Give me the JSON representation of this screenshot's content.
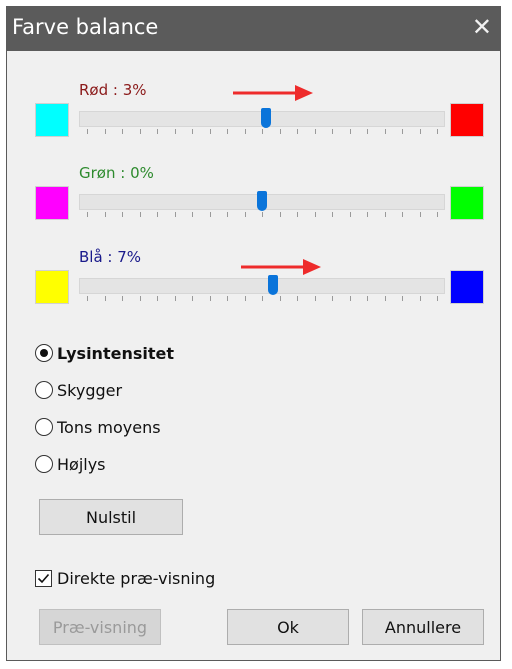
{
  "window": {
    "title": "Farve balance",
    "close_icon": "close-icon"
  },
  "sliders": [
    {
      "label": "Rød : 3%",
      "label_color": "#8b1a1a",
      "value_percent": 3,
      "left_color": "#00ffff",
      "right_color": "#ff0000"
    },
    {
      "label": "Grøn : 0%",
      "label_color": "#2e8b2e",
      "value_percent": 0,
      "left_color": "#ff00ff",
      "right_color": "#00ff00"
    },
    {
      "label": "Blå : 7%",
      "label_color": "#1a1a8b",
      "value_percent": 7,
      "left_color": "#ffff00",
      "right_color": "#0000ff"
    }
  ],
  "arrow_color": "#ee2b2b",
  "tone_options": [
    {
      "label": "Lysintensitet",
      "selected": true
    },
    {
      "label": "Skygger",
      "selected": false
    },
    {
      "label": "Tons moyens",
      "selected": false
    },
    {
      "label": "Højlys",
      "selected": false
    }
  ],
  "buttons": {
    "reset": "Nulstil",
    "preview": "Præ-visning",
    "ok": "Ok",
    "cancel": "Annullere"
  },
  "direct_preview": {
    "label": "Direkte præ-visning",
    "checked": true
  }
}
